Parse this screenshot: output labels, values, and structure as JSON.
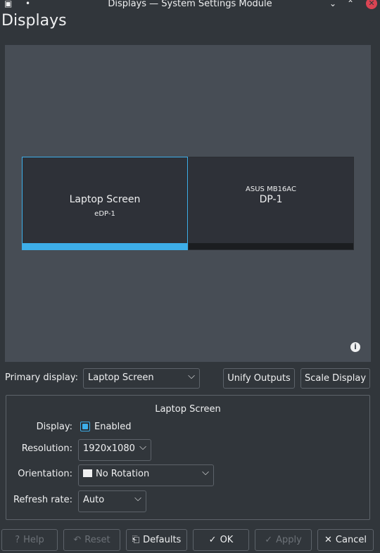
{
  "window": {
    "title": "Displays — System Settings Module"
  },
  "page": {
    "title": "Displays"
  },
  "monitors": [
    {
      "name": "Laptop Screen",
      "connector": "eDP-1",
      "selected": true
    },
    {
      "vendor": "ASUS MB16AC",
      "connector": "DP-1",
      "selected": false
    }
  ],
  "primary": {
    "label": "Primary display:",
    "value": "Laptop Screen"
  },
  "buttons": {
    "unify": "Unify Outputs",
    "scale": "Scale Display"
  },
  "output": {
    "title": "Laptop Screen",
    "display_label": "Display:",
    "enabled_label": "Enabled",
    "enabled": true,
    "resolution_label": "Resolution:",
    "resolution": "1920x1080",
    "orientation_label": "Orientation:",
    "orientation": "No Rotation",
    "refresh_label": "Refresh rate:",
    "refresh": "Auto"
  },
  "footer": {
    "help": "Help",
    "reset": "Reset",
    "defaults": "Defaults",
    "ok": "OK",
    "apply": "Apply",
    "cancel": "Cancel"
  },
  "colors": {
    "accent": "#3daee9",
    "background": "#31363b",
    "close": "#da4453"
  }
}
